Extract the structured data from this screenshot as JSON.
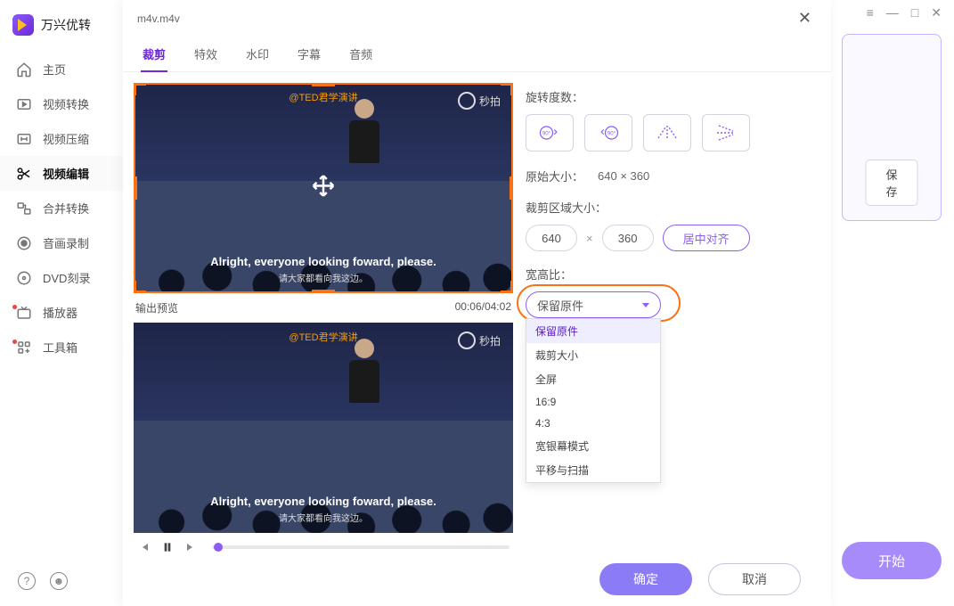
{
  "app": {
    "name": "万兴优转"
  },
  "sidebar": {
    "items": [
      {
        "label": "主页"
      },
      {
        "label": "视频转换"
      },
      {
        "label": "视频压缩"
      },
      {
        "label": "视频编辑"
      },
      {
        "label": "合并转换"
      },
      {
        "label": "音画录制"
      },
      {
        "label": "DVD刻录"
      },
      {
        "label": "播放器"
      },
      {
        "label": "工具箱"
      }
    ]
  },
  "right": {
    "save": "保存",
    "start": "开始"
  },
  "modal": {
    "filename": "m4v.m4v",
    "tabs": [
      {
        "label": "裁剪"
      },
      {
        "label": "特效"
      },
      {
        "label": "水印"
      },
      {
        "label": "字幕"
      },
      {
        "label": "音频"
      }
    ],
    "preview_label": "输出预览",
    "timecode": "00:06/04:02",
    "video": {
      "ted": "@TED君学演讲",
      "watermark": "秒拍",
      "subtitle_en": "Alright, everyone looking foward, please.",
      "subtitle_cn": "请大家都看向我这边。"
    }
  },
  "panel": {
    "rotation_label": "旋转度数：",
    "rotate90_cw": "90°",
    "rotate90_ccw": "90°",
    "orig_size_label": "原始大小：",
    "orig_size_value": "640 × 360",
    "crop_size_label": "裁剪区域大小：",
    "crop_w": "640",
    "crop_h": "360",
    "center_align": "居中对齐",
    "aspect_label": "宽高比：",
    "aspect_selected": "保留原件",
    "aspect_options": [
      "保留原件",
      "裁剪大小",
      "全屏",
      "16:9",
      "4:3",
      "宽银幕模式",
      "平移与扫描"
    ]
  },
  "footer": {
    "ok": "确定",
    "cancel": "取消"
  }
}
